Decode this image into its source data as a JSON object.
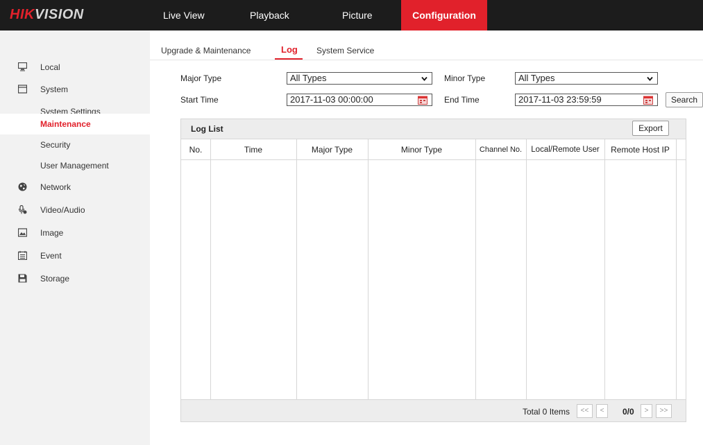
{
  "brand": {
    "logo_red": "HIK",
    "logo_rest": "VISION"
  },
  "nav": [
    {
      "label": "Live View"
    },
    {
      "label": "Playback"
    },
    {
      "label": "Picture"
    },
    {
      "label": "Configuration",
      "active": true
    }
  ],
  "sidebar": {
    "items": [
      {
        "label": "Local",
        "icon": "monitor-icon"
      },
      {
        "label": "System",
        "icon": "system-icon"
      },
      {
        "label": "System Settings"
      },
      {
        "label": "Maintenance",
        "active": true
      },
      {
        "label": "Security"
      },
      {
        "label": "User Management"
      },
      {
        "label": "Network",
        "icon": "globe-icon"
      },
      {
        "label": "Video/Audio",
        "icon": "mic-icon"
      },
      {
        "label": "Image",
        "icon": "image-icon"
      },
      {
        "label": "Event",
        "icon": "calendar-list-icon"
      },
      {
        "label": "Storage",
        "icon": "floppy-icon"
      }
    ]
  },
  "tabs": [
    {
      "label": "Upgrade & Maintenance"
    },
    {
      "label": "Log",
      "active": true
    },
    {
      "label": "System Service"
    }
  ],
  "filters": {
    "major_type_label": "Major Type",
    "major_type_value": "All Types",
    "minor_type_label": "Minor Type",
    "minor_type_value": "All Types",
    "start_time_label": "Start Time",
    "start_time_value": "2017-11-03 00:00:00",
    "end_time_label": "End Time",
    "end_time_value": "2017-11-03 23:59:59",
    "search_label": "Search"
  },
  "log_list": {
    "title": "Log List",
    "export_label": "Export",
    "columns": [
      "No.",
      "Time",
      "Major Type",
      "Minor Type",
      "Channel No.",
      "Local/Remote User",
      "Remote Host IP"
    ],
    "rows": [],
    "total_text": "Total 0 Items",
    "page_info": "0/0",
    "pager": {
      "first": "<<",
      "prev": "<",
      "next": ">",
      "last": ">>"
    }
  },
  "colors": {
    "accent": "#e1212b",
    "topbar": "#1c1c1c",
    "sidebar_bg": "#f2f2f2"
  }
}
